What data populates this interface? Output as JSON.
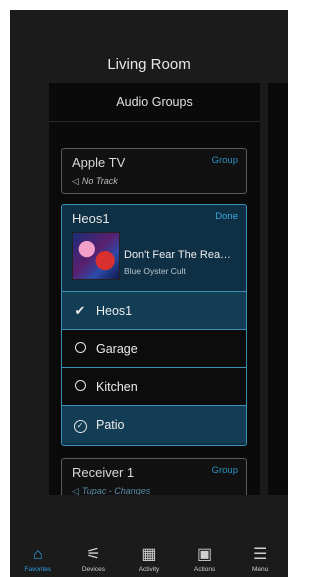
{
  "room": {
    "title": "Living Room"
  },
  "panel": {
    "header": "Audio Groups"
  },
  "apple_tv": {
    "title": "Apple TV",
    "link": "Group",
    "status": "No Track",
    "status_icon": "speaker-icon"
  },
  "heos": {
    "title": "Heos1",
    "done": "Done",
    "track": "Don't Fear The Rea…",
    "artist": "Blue Oyster Cult",
    "rows": [
      {
        "label": "Heos1",
        "icon": "check-icon"
      },
      {
        "label": "Garage",
        "icon": "radio-empty-icon"
      },
      {
        "label": "Kitchen",
        "icon": "radio-empty-icon"
      },
      {
        "label": "Patio",
        "icon": "radio-checked-icon"
      }
    ]
  },
  "receiver": {
    "title": "Receiver 1",
    "link": "Group",
    "status": "Tupac - Changes"
  },
  "nav": [
    {
      "label": "Favorites",
      "icon": "home-icon",
      "active": true
    },
    {
      "label": "Devices",
      "icon": "devices-icon",
      "active": false
    },
    {
      "label": "Activity",
      "icon": "activity-icon",
      "active": false
    },
    {
      "label": "Actions",
      "icon": "calendar-icon",
      "active": false
    },
    {
      "label": "Menu",
      "icon": "menu-icon",
      "active": false
    }
  ],
  "colors": {
    "accent": "#2e9fe3",
    "selected_bg": "#0e2f44",
    "link": "#2b8fc4"
  }
}
